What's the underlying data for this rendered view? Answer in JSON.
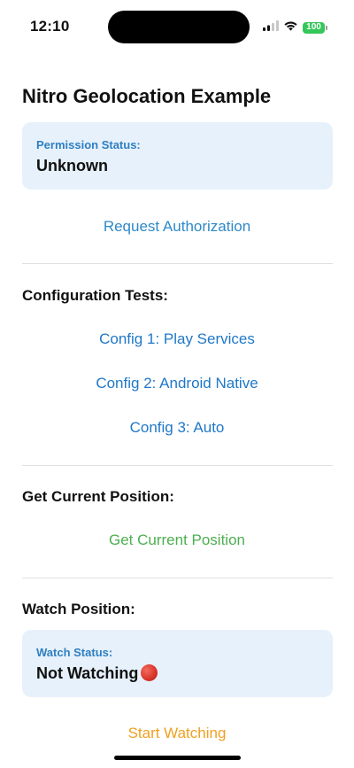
{
  "status_bar": {
    "time": "12:10",
    "battery": "100",
    "icons": [
      "cellular-signal-icon",
      "wifi-icon",
      "battery-icon"
    ]
  },
  "app": {
    "title": "Nitro Geolocation Example"
  },
  "permission": {
    "label": "Permission Status:",
    "value": "Unknown",
    "request_button": "Request Authorization"
  },
  "config": {
    "title": "Configuration Tests:",
    "buttons": [
      "Config 1: Play Services",
      "Config 2: Android Native",
      "Config 3: Auto"
    ]
  },
  "current_position": {
    "title": "Get Current Position:",
    "button": "Get Current Position"
  },
  "watch": {
    "title": "Watch Position:",
    "label": "Watch Status:",
    "value": "Not Watching",
    "start_button": "Start Watching"
  },
  "colors": {
    "card_background": "#e6f1fb",
    "link_blue": "#2f89c9",
    "green": "#4caf50",
    "orange": "#f0a020",
    "battery_green": "#34c759"
  }
}
